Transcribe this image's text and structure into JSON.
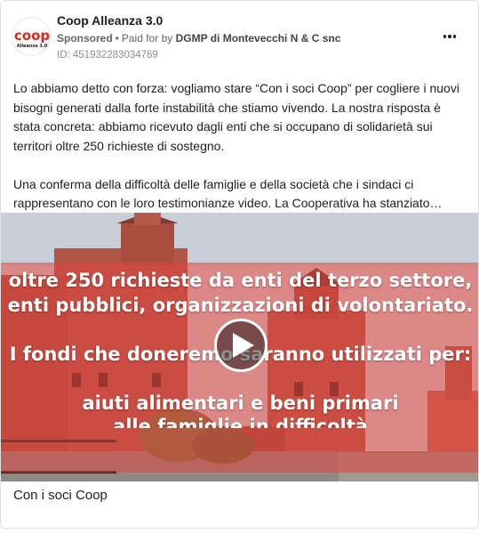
{
  "post": {
    "page_name": "Coop Alleanza 3.0",
    "sponsored": "Sponsored",
    "paid_for": "Paid for by",
    "advertiser": "DGMP di Montevecchi N & C snc",
    "ad_id": "ID: 451932283034769",
    "logo_word": "coop",
    "logo_sub": "Alleanza 3.0",
    "more_icon": "more-horizontal-icon",
    "body": [
      "Lo abbiamo detto con forza: vogliamo stare “Con i soci Coop” per cogliere i nuovi bisogni generati dalla forte instabilità che stiamo vivendo. La nostra risposta è stata concreta: abbiamo ricevuto dagli enti che si occupano di solidarietà sui territori oltre 250 richieste di sostegno.",
      "Una conferma della difficoltà delle famiglie e della società che i sindaci ci rappresentano con le loro testimonianze video. La Cooperativa ha stanziato…"
    ],
    "caption": "Con i soci Coop"
  },
  "video": {
    "play_icon": "play-icon",
    "overlay_lines": [
      "oltre 250 richieste da enti del terzo settore,",
      "enti pubblici, organizzazioni di volontariato.",
      "I fondi che doneremo saranno utilizzati per:",
      "aiuti alimentari e beni primari",
      "alle famiglie in difficoltà"
    ]
  },
  "colors": {
    "brand_red": "#e2231a",
    "overlay_red": "#e0443c",
    "sky": "#d6dbe2"
  }
}
